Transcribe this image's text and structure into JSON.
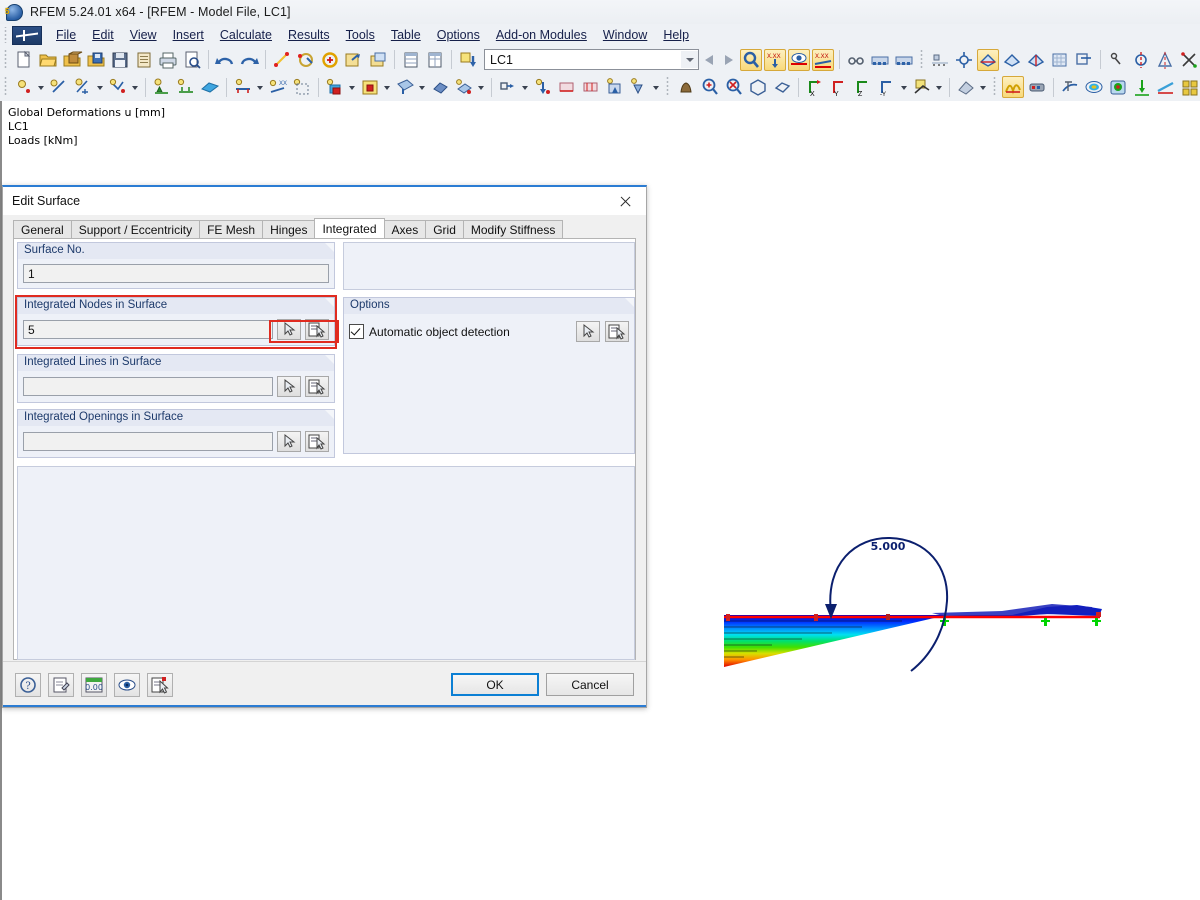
{
  "window": {
    "title": "RFEM 5.24.01 x64 - [RFEM - Model File, LC1]",
    "app_icon": "rfem-app-icon",
    "icon_badge": "5"
  },
  "menubar": {
    "logo_icon": "rfem-logo-icon",
    "items": [
      {
        "label": "File",
        "accel": "F"
      },
      {
        "label": "Edit",
        "accel": "E"
      },
      {
        "label": "View",
        "accel": "V"
      },
      {
        "label": "Insert",
        "accel": "I"
      },
      {
        "label": "Calculate",
        "accel": "C"
      },
      {
        "label": "Results",
        "accel": "R"
      },
      {
        "label": "Tools",
        "accel": "T"
      },
      {
        "label": "Table",
        "accel": "b"
      },
      {
        "label": "Options",
        "accel": "O"
      },
      {
        "label": "Add-on Modules",
        "accel": "A"
      },
      {
        "label": "Window",
        "accel": "W"
      },
      {
        "label": "Help",
        "accel": "H"
      }
    ]
  },
  "toolbar_top": {
    "load_case_combo": {
      "value": "LC1",
      "name": "load-case-combobox"
    },
    "icons": [
      "new-file-icon",
      "open-file-icon",
      "open-package-icon",
      "save-package-icon",
      "save-icon",
      "clipboard-icon",
      "print-icon",
      "print-preview-icon",
      "undo-icon",
      "redo-icon",
      "edit-node-icon",
      "edit-line-icon",
      "edit-member-icon",
      "edit-surface-icon",
      "solid-icon",
      "table-icon",
      "table-detail-icon",
      "import-load-icon",
      "nav-prev-icon",
      "nav-next-icon",
      "results-deform-icon",
      "results-value-icon",
      "results-view-icon",
      "results-scale-icon",
      "glasses-icon",
      "render-bar-icon",
      "render-bar2-icon",
      "grid-snap-icon",
      "snap-center-icon",
      "wireframe-active-icon",
      "wireframe-icon",
      "solid-model-icon",
      "render-surface-icon",
      "section-icon",
      "measure-icon",
      "mirror-axis-icon",
      "mirror-plane-icon",
      "cross-snap-icon",
      "info-icon",
      "settings-camera-icon",
      "print-config-icon"
    ]
  },
  "toolbar_second": {
    "icons": [
      "add-node-icon",
      "add-line-icon",
      "add-dim-line-icon",
      "add-polyline-icon",
      "add-support-icon",
      "add-line-support-icon",
      "add-surface-icon",
      "add-member-icon",
      "add-member-xx-icon",
      "add-mesh-icon",
      "add-solid-icon",
      "add-opening-icon",
      "add-load-icon",
      "solid-body-icon",
      "surface-load-icon",
      "member-set-icon",
      "load-node-icon",
      "load-line-icon",
      "load-surface-icon",
      "load-free-icon",
      "load-apply-icon",
      "pan-hand-icon",
      "zoom-in-icon",
      "zoom-out-icon",
      "zoom-box-icon",
      "zoom-window-icon",
      "view-x-icon",
      "view-y-icon",
      "view-z-icon",
      "view-ny-icon",
      "render-mode-icon",
      "perspective-icon",
      "deformation-active-icon",
      "results-bar-icon",
      "beam-results-icon",
      "color-spectrum-icon",
      "solid-results-icon",
      "support-results-icon",
      "line-results-icon",
      "panel-results-icon",
      "diagram-results-icon",
      "table-results-icon"
    ]
  },
  "viewport": {
    "labels": [
      "Global Deformations u [mm]",
      "LC1",
      "Loads [kNm]"
    ],
    "moment_label": "5.000"
  },
  "dialog": {
    "title": "Edit Surface",
    "close_icon": "close-icon",
    "tabs": [
      {
        "label": "General",
        "selected": false
      },
      {
        "label": "Support / Eccentricity",
        "selected": false
      },
      {
        "label": "FE Mesh",
        "selected": false
      },
      {
        "label": "Hinges",
        "selected": false
      },
      {
        "label": "Integrated",
        "selected": true
      },
      {
        "label": "Axes",
        "selected": false
      },
      {
        "label": "Grid",
        "selected": false
      },
      {
        "label": "Modify Stiffness",
        "selected": false
      }
    ],
    "groups": {
      "surface_no": {
        "label": "Surface No.",
        "value": "1"
      },
      "integrated_nodes": {
        "label": "Integrated Nodes in Surface",
        "value": "5",
        "highlighted": true
      },
      "integrated_lines": {
        "label": "Integrated Lines in Surface",
        "value": ""
      },
      "integrated_openings": {
        "label": "Integrated Openings in Surface",
        "value": ""
      },
      "options": {
        "label": "Options",
        "checkbox": {
          "label": "Automatic object detection",
          "checked": true
        }
      }
    },
    "footer": {
      "tool_icons": [
        "help-icon",
        "comment-icon",
        "units-icon",
        "visibility-icon",
        "select-object-icon"
      ],
      "ok_label": "OK",
      "cancel_label": "Cancel"
    }
  },
  "colors": {
    "accent": "#2b7cd3",
    "highlight_red": "#e02b20",
    "group_header_bg": "#e4e8f3",
    "group_header_text": "#1d3a6b",
    "moment_arrow": "#0b1f6e",
    "member_line": "#ff0000",
    "support_green": "#00d400"
  }
}
